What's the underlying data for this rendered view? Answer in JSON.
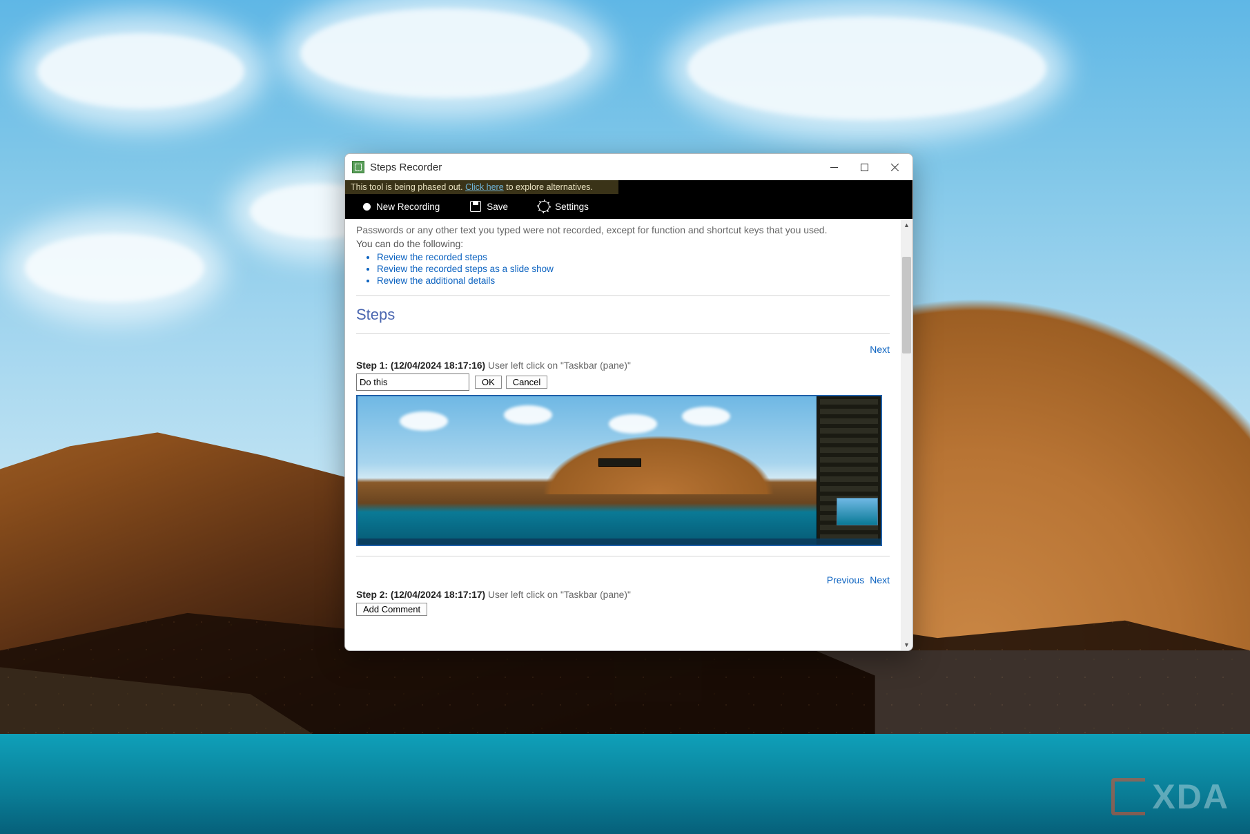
{
  "watermark": "XDA",
  "window": {
    "title": "Steps Recorder",
    "banner_pre": "This tool is being phased out. ",
    "banner_link": "Click here",
    "banner_post": " to explore alternatives.",
    "toolbar": {
      "new_recording": "New Recording",
      "save": "Save",
      "settings": "Settings"
    }
  },
  "content": {
    "intro_line1": "Passwords or any other text you typed were not recorded, except for function and shortcut keys that you used.",
    "intro_line2": "You can do the following:",
    "links": {
      "review_steps": "Review the recorded steps",
      "review_slideshow": "Review the recorded steps as a slide show",
      "review_details": "Review the additional details"
    },
    "section_heading": "Steps",
    "nav": {
      "next": "Next",
      "previous": "Previous"
    },
    "steps": [
      {
        "label_prefix": "Step 1: ",
        "timestamp": "(12/04/2024 18:17:16)",
        "action": " User left click on \"Taskbar (pane)\"",
        "comment_value": "Do this",
        "ok": "OK",
        "cancel": "Cancel"
      },
      {
        "label_prefix": "Step 2: ",
        "timestamp": "(12/04/2024 18:17:17)",
        "action": " User left click on \"Taskbar (pane)\"",
        "add_comment": "Add Comment"
      }
    ]
  }
}
